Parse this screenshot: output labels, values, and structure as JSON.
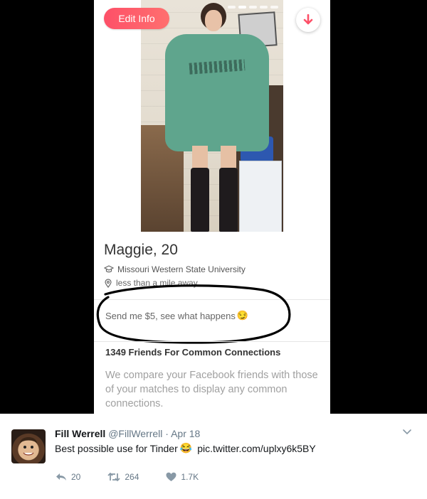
{
  "profile_card": {
    "edit_button_label": "Edit Info",
    "name_age": "Maggie, 20",
    "school": "Missouri Western State University",
    "distance": "less than a mile away",
    "bio": "Send me $5, see what happens",
    "bio_emoji": "😏",
    "common_connections_heading": "1349 Friends For Common Connections",
    "common_connections_text": "We compare your Facebook friends with those of your matches to display any common connections.",
    "photo_count": 5,
    "active_photo": 2,
    "accent_color": "#fd5068"
  },
  "tweet": {
    "author_name": "Fill Werrell",
    "author_handle": "@FillWerrell",
    "separator": "·",
    "date": "Apr 18",
    "text": "Best possible use for Tinder",
    "text_emoji": "😂",
    "link": "pic.twitter.com/uplxy6k5BY",
    "replies": "20",
    "retweets": "264",
    "likes": "1.7K"
  }
}
